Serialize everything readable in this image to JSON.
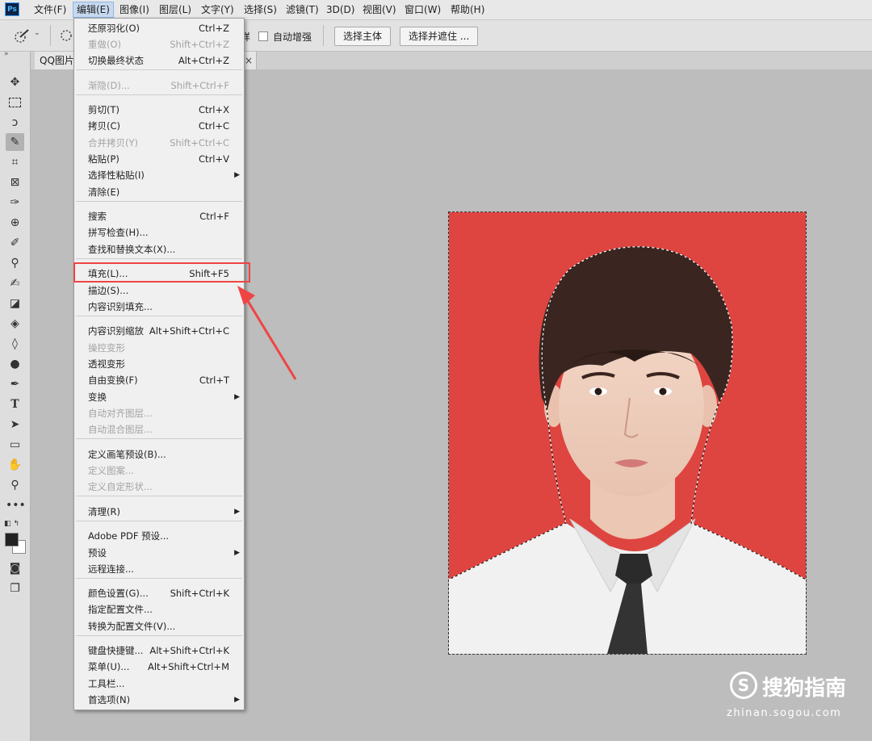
{
  "app": {
    "logo": "Ps"
  },
  "menubar": [
    "文件(F)",
    "编辑(E)",
    "图像(I)",
    "图层(L)",
    "文字(Y)",
    "选择(S)",
    "滤镜(T)",
    "3D(D)",
    "视图(V)",
    "窗口(W)",
    "帮助(H)"
  ],
  "menubar_active": "编辑(E)",
  "options": {
    "auto_enhance": "自动增强",
    "checkbox_prefix": "样",
    "select_subject": "选择主体",
    "select_and_mask": "选择并遮住 ..."
  },
  "doc_tab": {
    "title": "QQ图片",
    "close": "×"
  },
  "edit_menu": [
    {
      "label": "还原羽化(O)",
      "shortcut": "Ctrl+Z"
    },
    {
      "label": "重做(O)",
      "shortcut": "Shift+Ctrl+Z",
      "disabled": true
    },
    {
      "label": "切换最终状态",
      "shortcut": "Alt+Ctrl+Z"
    },
    {
      "label": "渐隐(D)...",
      "shortcut": "Shift+Ctrl+F",
      "disabled": true
    },
    {
      "label": "剪切(T)",
      "shortcut": "Ctrl+X"
    },
    {
      "label": "拷贝(C)",
      "shortcut": "Ctrl+C"
    },
    {
      "label": "合并拷贝(Y)",
      "shortcut": "Shift+Ctrl+C",
      "disabled": true
    },
    {
      "label": "粘贴(P)",
      "shortcut": "Ctrl+V"
    },
    {
      "label": "选择性粘贴(I)",
      "shortcut": "",
      "submenu": true
    },
    {
      "label": "清除(E)",
      "shortcut": ""
    },
    {
      "label": "搜索",
      "shortcut": "Ctrl+F"
    },
    {
      "label": "拼写检查(H)...",
      "shortcut": ""
    },
    {
      "label": "查找和替换文本(X)...",
      "shortcut": ""
    },
    {
      "label": "填充(L)...",
      "shortcut": "Shift+F5"
    },
    {
      "label": "描边(S)...",
      "shortcut": ""
    },
    {
      "label": "内容识别填充...",
      "shortcut": ""
    },
    {
      "label": "内容识别缩放",
      "shortcut": "Alt+Shift+Ctrl+C"
    },
    {
      "label": "操控变形",
      "shortcut": "",
      "disabled": true
    },
    {
      "label": "透视变形",
      "shortcut": ""
    },
    {
      "label": "自由变换(F)",
      "shortcut": "Ctrl+T"
    },
    {
      "label": "变换",
      "shortcut": "",
      "submenu": true
    },
    {
      "label": "自动对齐图层...",
      "shortcut": "",
      "disabled": true
    },
    {
      "label": "自动混合图层...",
      "shortcut": "",
      "disabled": true
    },
    {
      "label": "定义画笔预设(B)...",
      "shortcut": ""
    },
    {
      "label": "定义图案...",
      "shortcut": "",
      "disabled": true
    },
    {
      "label": "定义自定形状...",
      "shortcut": "",
      "disabled": true
    },
    {
      "label": "清理(R)",
      "shortcut": "",
      "submenu": true
    },
    {
      "label": "Adobe PDF 预设...",
      "shortcut": ""
    },
    {
      "label": "预设",
      "shortcut": "",
      "submenu": true
    },
    {
      "label": "远程连接...",
      "shortcut": ""
    },
    {
      "label": "颜色设置(G)...",
      "shortcut": "Shift+Ctrl+K"
    },
    {
      "label": "指定配置文件...",
      "shortcut": ""
    },
    {
      "label": "转换为配置文件(V)...",
      "shortcut": ""
    },
    {
      "label": "键盘快捷键...",
      "shortcut": "Alt+Shift+Ctrl+K"
    },
    {
      "label": "菜单(U)...",
      "shortcut": "Alt+Shift+Ctrl+M"
    },
    {
      "label": "工具栏...",
      "shortcut": ""
    },
    {
      "label": "首选项(N)",
      "shortcut": "",
      "submenu": true
    }
  ],
  "highlighted_item": "填充(L)...",
  "colors": {
    "canvas_bg": "#de4540",
    "highlight": "#ef4444",
    "workspace": "#bdbdbd"
  },
  "watermark": {
    "logo": "S",
    "text": "搜狗指南",
    "url": "zhinan.sogou.com"
  }
}
